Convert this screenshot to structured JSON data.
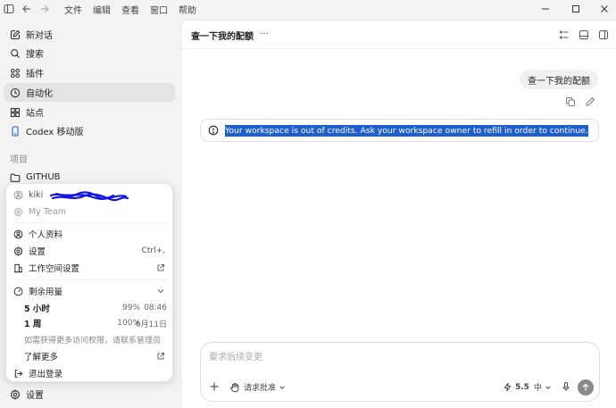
{
  "titlebar": {
    "menus": [
      "文件",
      "编辑",
      "查看",
      "窗口",
      "帮助"
    ]
  },
  "sidebar": {
    "items": [
      {
        "label": "新对话",
        "icon": "edit-icon"
      },
      {
        "label": "搜索",
        "icon": "search-icon"
      },
      {
        "label": "插件",
        "icon": "grid-icon"
      },
      {
        "label": "自动化",
        "icon": "clock-icon"
      },
      {
        "label": "站点",
        "icon": "globe-icon"
      },
      {
        "label": "Codex 移动版",
        "icon": "phone-icon"
      }
    ],
    "projects_label": "项目",
    "project": "GITHUB",
    "settings_label": "设置"
  },
  "popup": {
    "account": "kiki",
    "team": "My Team",
    "profile": "个人资料",
    "settings": "设置",
    "settings_shortcut": "Ctrl+,",
    "workspace_settings": "工作空间设置",
    "usage_label": "剩余用量",
    "usage": [
      {
        "label": "5 小时",
        "pct": "99%",
        "time": "08:46"
      },
      {
        "label": "1 周",
        "pct": "100%",
        "time": "6月11日"
      }
    ],
    "hint": "如需获得更多访问权限，请联系管理员",
    "learn_more": "了解更多",
    "logout": "退出登录"
  },
  "main": {
    "title": "查一下我的配额",
    "more": "···",
    "user_message": "查一下我的配额",
    "alert_text": "Your workspace is out of credits. Ask your workspace owner to refill in order to continue.",
    "composer_placeholder": "要求后续变更",
    "approval_label": "请求批准",
    "model": "5.5",
    "effort": "中"
  },
  "colors": {
    "selection": "#1e5fcc",
    "active_item": "#e4e4e4"
  }
}
